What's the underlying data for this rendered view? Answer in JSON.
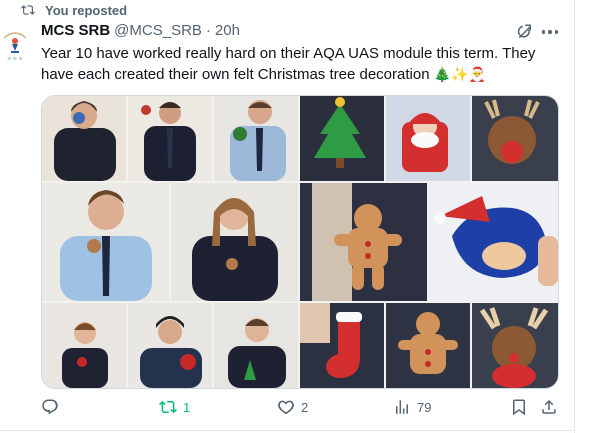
{
  "repost": {
    "label": "You reposted"
  },
  "author": {
    "name": "MCS SRB",
    "handle": "@MCS_SRB",
    "separator": "·",
    "time": "20h"
  },
  "tweet": {
    "text": "Year 10 have worked really hard on their AQA UAS module this term. They have each created their own felt Christmas tree decoration",
    "emojis": "🎄✨🎅"
  },
  "media": {
    "description_tiles": [
      "student-holding-ornament-1",
      "student-holding-ornament-2",
      "student-holding-ornament-3",
      "felt-christmas-tree",
      "felt-santa",
      "felt-reindeer",
      "student-holding-ornament-4",
      "student-holding-ornament-5",
      "felt-gingerbread-man",
      "felt-sonic-santa",
      "student-holding-ornament-6",
      "student-holding-ornament-7",
      "student-holding-ornament-8",
      "felt-stocking",
      "felt-gingerbread-man-2",
      "felt-reindeer-2"
    ]
  },
  "actions": {
    "reply": {
      "icon": "reply-icon",
      "count": ""
    },
    "repost": {
      "icon": "repost-icon",
      "count": "1",
      "color": "#00ba7c"
    },
    "like": {
      "icon": "heart-icon",
      "count": "2"
    },
    "views": {
      "icon": "views-icon",
      "count": "79"
    }
  },
  "colors": {
    "text": "#0f1419",
    "secondary": "#536471",
    "repost_green": "#00ba7c",
    "border": "#cfd9de"
  }
}
